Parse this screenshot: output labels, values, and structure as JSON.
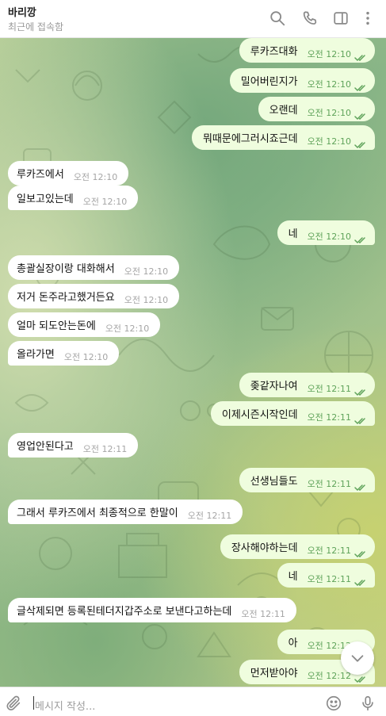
{
  "header": {
    "title": "바리깡",
    "status": "최근에 접속함"
  },
  "composer": {
    "placeholder": "메시지 작성..."
  },
  "colors": {
    "outgoing_bubble": "#effdde",
    "incoming_bubble": "#ffffff",
    "outgoing_time": "#5fa35a",
    "incoming_time": "#a5a5a5",
    "read_check": "#5fa35a"
  },
  "icons": [
    "search-icon",
    "phone-icon",
    "sidebar-icon",
    "more-vertical-icon",
    "chevron-down-icon",
    "paperclip-icon",
    "emoji-icon",
    "microphone-icon",
    "double-check-icon"
  ],
  "messages": [
    {
      "dir": "out",
      "text": "루카즈대화",
      "time": "오전 12:10",
      "read": true
    },
    {
      "dir": "out",
      "text": "밀어버린지가",
      "time": "오전 12:10",
      "read": true
    },
    {
      "dir": "out",
      "text": "오랜데",
      "time": "오전 12:10",
      "read": true
    },
    {
      "dir": "out",
      "text": "뭐때문에그러시죠근데",
      "time": "오전 12:10",
      "read": true
    },
    {
      "dir": "in",
      "text": "루카즈에서",
      "time": "오전 12:10"
    },
    {
      "dir": "in",
      "text": "일보고있는데",
      "time": "오전 12:10"
    },
    {
      "dir": "out",
      "text": "네",
      "time": "오전 12:10",
      "read": true
    },
    {
      "dir": "in",
      "text": "총괄실장이랑 대화해서",
      "time": "오전 12:10"
    },
    {
      "dir": "in",
      "text": "저거 돈주라고했거든요",
      "time": "오전 12:10"
    },
    {
      "dir": "in",
      "text": "얼마 되도안는돈에",
      "time": "오전 12:10"
    },
    {
      "dir": "in",
      "text": "올라가면",
      "time": "오전 12:10"
    },
    {
      "dir": "out",
      "text": "좆같자나여",
      "time": "오전 12:11",
      "read": true
    },
    {
      "dir": "out",
      "text": "이제시즌시작인데",
      "time": "오전 12:11",
      "read": true
    },
    {
      "dir": "in",
      "text": "영업안된다고",
      "time": "오전 12:11"
    },
    {
      "dir": "out",
      "text": "선생님들도",
      "time": "오전 12:11",
      "read": true
    },
    {
      "dir": "in",
      "text": "그래서 루카즈에서 최종적으로 한말이",
      "time": "오전 12:11"
    },
    {
      "dir": "out",
      "text": "장사해야하는데",
      "time": "오전 12:11",
      "read": true
    },
    {
      "dir": "out",
      "text": "네",
      "time": "오전 12:11",
      "read": true
    },
    {
      "dir": "in",
      "text": "글삭제되면 등록된테더지갑주소로 보낸다고하는데",
      "time": "오전 12:11"
    },
    {
      "dir": "out",
      "text": "아",
      "time": "오전 12:12",
      "read": true
    },
    {
      "dir": "out",
      "text": "먼저받아야",
      "time": "오전 12:12",
      "read": true
    }
  ]
}
